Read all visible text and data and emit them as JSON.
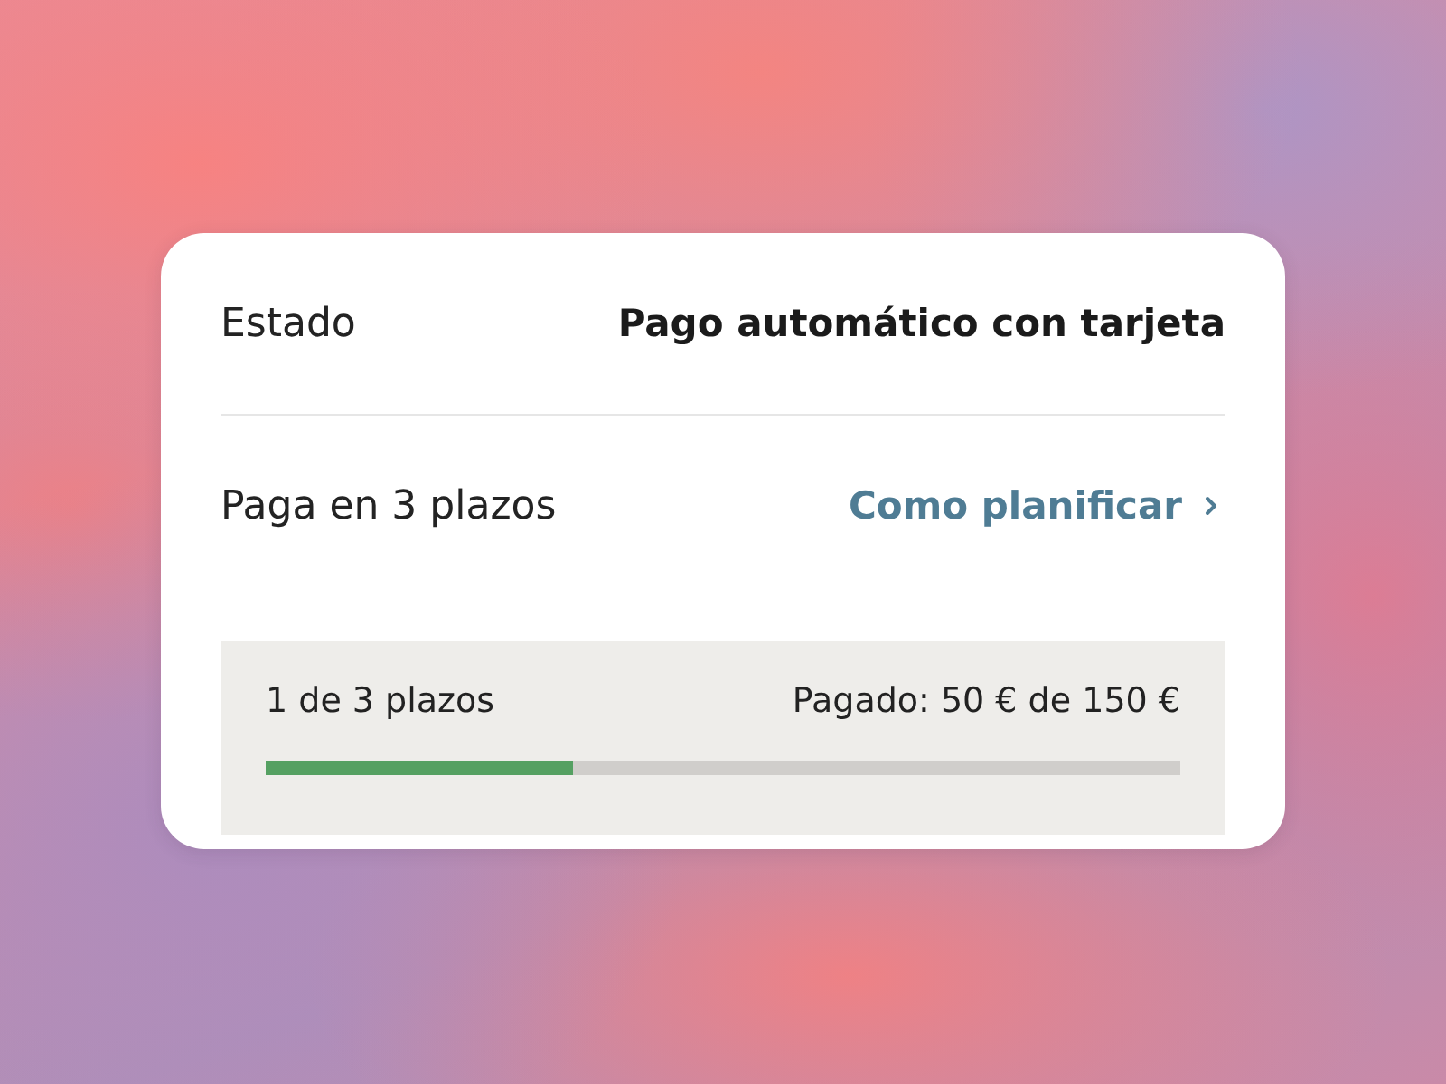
{
  "status_row": {
    "label": "Estado",
    "value": "Pago automático con tarjeta"
  },
  "plan_row": {
    "label": "Paga en 3 plazos",
    "link": "Como planificar"
  },
  "progress": {
    "installments": "1 de 3 plazos",
    "paid": "Pagado: 50 € de 150 €",
    "level": 0.336
  }
}
